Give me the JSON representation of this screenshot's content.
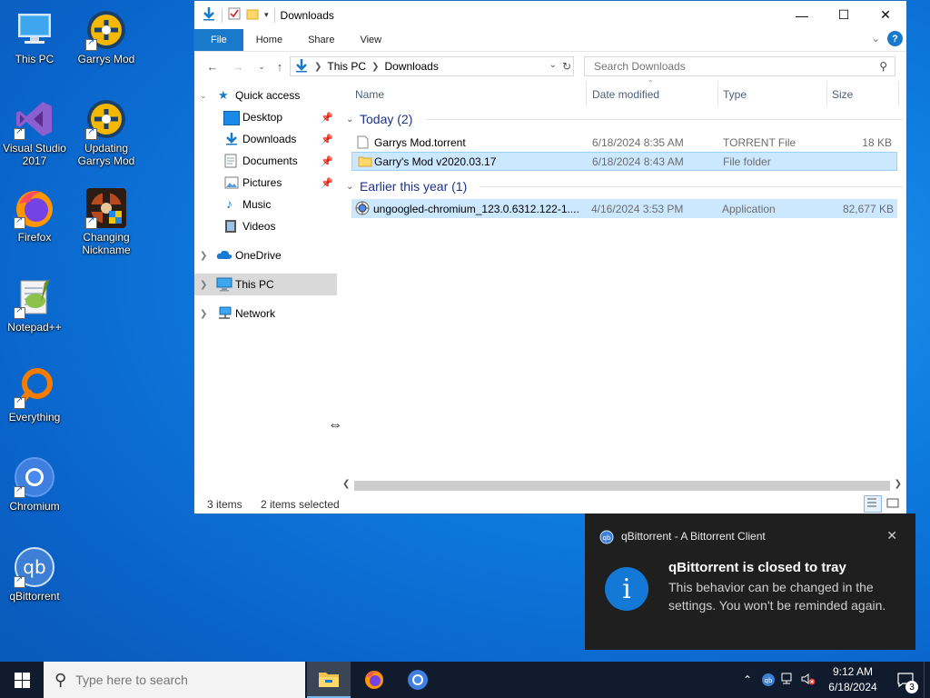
{
  "desktop": {
    "icons": [
      {
        "label": "This PC"
      },
      {
        "label": "Garrys Mod"
      },
      {
        "label": "Visual Studio 2017"
      },
      {
        "label": "Updating Garrys Mod"
      },
      {
        "label": "Firefox"
      },
      {
        "label": "Changing Nickname"
      },
      {
        "label": "Notepad++"
      },
      {
        "label": "Everything"
      },
      {
        "label": "Chromium"
      },
      {
        "label": "qBittorrent"
      }
    ]
  },
  "explorer": {
    "title": "Downloads",
    "ribbon": {
      "file": "File",
      "home": "Home",
      "share": "Share",
      "view": "View"
    },
    "address": {
      "crumbs": [
        "This PC",
        "Downloads"
      ]
    },
    "search": {
      "placeholder": "Search Downloads"
    },
    "nav": {
      "quick_access": "Quick access",
      "desktop": "Desktop",
      "downloads": "Downloads",
      "documents": "Documents",
      "pictures": "Pictures",
      "music": "Music",
      "videos": "Videos",
      "onedrive": "OneDrive",
      "this_pc": "This PC",
      "network": "Network"
    },
    "columns": {
      "name": "Name",
      "date": "Date modified",
      "type": "Type",
      "size": "Size"
    },
    "groups": [
      {
        "label": "Today (2)",
        "rows": [
          {
            "name": "Garrys Mod.torrent",
            "date": "6/18/2024 8:35 AM",
            "type": "TORRENT File",
            "size": "18 KB"
          },
          {
            "name": "Garry's Mod v2020.03.17",
            "date": "6/18/2024 8:43 AM",
            "type": "File folder",
            "size": ""
          }
        ]
      },
      {
        "label": "Earlier this year (1)",
        "rows": [
          {
            "name": "ungoogled-chromium_123.0.6312.122-1....",
            "date": "4/16/2024 3:53 PM",
            "type": "Application",
            "size": "82,677 KB"
          }
        ]
      }
    ],
    "status": {
      "count": "3 items",
      "selected": "2 items selected"
    }
  },
  "toast": {
    "app": "qBittorrent - A Bittorrent Client",
    "title": "qBittorrent is closed to tray",
    "body": "This behavior can be changed in the settings. You won't be reminded again."
  },
  "taskbar": {
    "search_placeholder": "Type here to search",
    "time": "9:12 AM",
    "date": "6/18/2024",
    "notifications": "3"
  },
  "colors": {
    "accent": "#1979ca",
    "selection": "#cce8ff",
    "taskbar": "#101b2e",
    "toast": "#1f1f1f"
  }
}
